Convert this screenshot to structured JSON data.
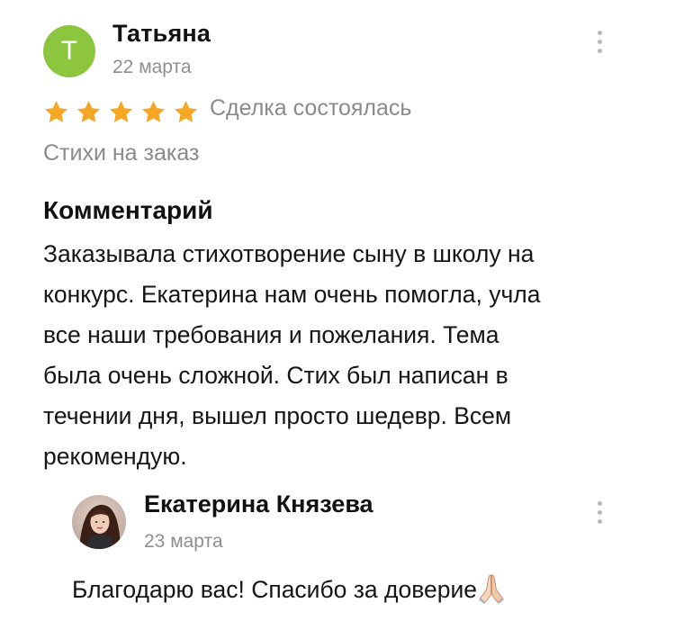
{
  "review": {
    "avatar_initial": "Т",
    "avatar_color": "#8cc63e",
    "author": "Татьяна",
    "date": "22 марта",
    "menu_icon": "more-vertical-icon",
    "rating": 5,
    "rating_max": 5,
    "star_color": "#f5a623",
    "deal_status": "Сделка состоялась",
    "service": "Стихи на заказ",
    "comment_heading": "Комментарий",
    "comment_lines": [
      "Заказывала стихотворение сыну в школу на",
      "конкурс. Екатерина нам очень помогла, учла",
      "все наши требования и пожелания. Тема",
      "была очень сложной. Стих был написан в",
      "течении дня, вышел просто шедевр. Всем",
      "рекомендую."
    ]
  },
  "reply": {
    "author": "Екатерина Князева",
    "date": "23 марта",
    "menu_icon": "more-vertical-icon",
    "text": "Благодарю вас! Спасибо за доверие",
    "emoji": "folded-hands-icon"
  }
}
